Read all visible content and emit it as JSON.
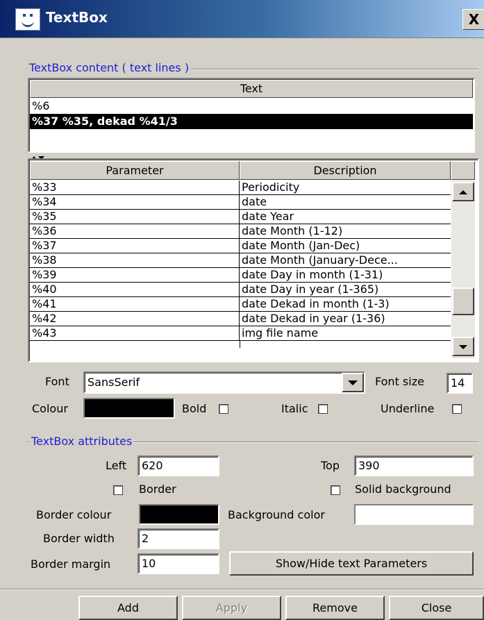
{
  "window": {
    "title": "TextBox",
    "close_label": "X"
  },
  "content_group": {
    "label": "TextBox content ( text lines )",
    "column_header": "Text",
    "lines": [
      "%6",
      "%37 %35, dekad %41/3"
    ],
    "selected_index": 1
  },
  "splitter": {
    "icon": "split-arrows-icon"
  },
  "params": {
    "headers": {
      "parameter": "Parameter",
      "description": "Description"
    },
    "rows": [
      {
        "param": "%33",
        "desc": "Periodicity"
      },
      {
        "param": "%34",
        "desc": "date"
      },
      {
        "param": "%35",
        "desc": "date Year"
      },
      {
        "param": "%36",
        "desc": "date Month (1-12)"
      },
      {
        "param": "%37",
        "desc": "date Month (Jan-Dec)"
      },
      {
        "param": "%38",
        "desc": "date Month (January-Dece..."
      },
      {
        "param": "%39",
        "desc": "date Day in month (1-31)"
      },
      {
        "param": "%40",
        "desc": "date Day in year (1-365)"
      },
      {
        "param": "%41",
        "desc": "date Dekad in month (1-3)"
      },
      {
        "param": "%42",
        "desc": "date Dekad in year  (1-36)"
      },
      {
        "param": "%43",
        "desc": "img file name"
      }
    ]
  },
  "font": {
    "font_label": "Font",
    "font_value": "SansSerif",
    "size_label": "Font size",
    "size_value": "14",
    "colour_label": "Colour",
    "colour_value": "#000000",
    "bold_label": "Bold",
    "italic_label": "Italic",
    "underline_label": "Underline"
  },
  "attributes": {
    "label": "TextBox attributes",
    "left_label": "Left",
    "left_value": "620",
    "top_label": "Top",
    "top_value": "390",
    "border_label": "Border",
    "solid_bg_label": "Solid background",
    "border_colour_label": "Border colour",
    "border_colour_value": "#000000",
    "bg_color_label": "Background color",
    "bg_color_value": "#ffffff",
    "border_width_label": "Border width",
    "border_width_value": "2",
    "border_margin_label": "Border margin",
    "border_margin_value": "10",
    "show_hide_label": "Show/Hide text Parameters"
  },
  "buttons": {
    "add": "Add",
    "apply": "Apply",
    "remove": "Remove",
    "close": "Close"
  }
}
